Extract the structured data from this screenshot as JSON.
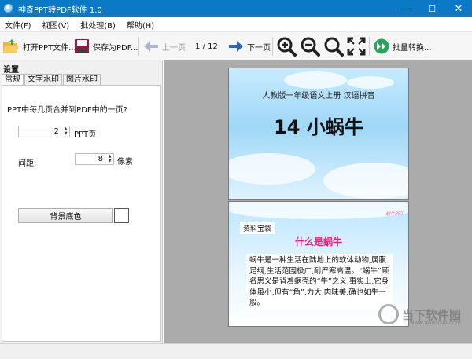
{
  "window": {
    "title": "神奇PPT转PDF软件 1.0",
    "controls": {
      "minimize": "—",
      "maximize": "☐",
      "close": "✕"
    }
  },
  "menu": [
    "文件(F)",
    "视图(V)",
    "批处理(B)",
    "帮助(H)"
  ],
  "toolbar": {
    "open_label": "打开PPT文件...",
    "save_label": "保存为PDF...",
    "prev_label": "上一页",
    "page_indicator": "1 / 12",
    "next_label": "下一页",
    "batch_label": "批量转换..."
  },
  "settings": {
    "panel_title": "设置",
    "tabs": [
      "常规",
      "文字水印",
      "图片水印"
    ],
    "pages_question": "PPT中每几页合并到PDF中的一页?",
    "pages_value": "2",
    "pages_unit": "PPT页",
    "spacing_label": "间距:",
    "spacing_value": "8",
    "spacing_unit": "像素",
    "bg_color_button": "背景底色"
  },
  "preview": {
    "slide1": {
      "subtitle": "人教版一年级语文上册    汉语拼音",
      "title": "14 小蜗牛"
    },
    "slide2": {
      "tag": "资料宝袋",
      "heading": "什么是蜗牛",
      "logo": "蜗牛PPT",
      "body": "蜗牛是一种生活在陆地上的软体动物,属腹足纲,生活范围极广,耐严寒高温。“蜗牛”顾名思义是背着蜗壳的“牛”之义,事实上,它身体虽小,但有“角”,力大,肉味美,确也如牛一般。"
    }
  },
  "watermark": {
    "name": "当下软件园",
    "url": "www.downxia.com"
  },
  "colors": {
    "titlebar": "#0b79c6",
    "preview_bg": "#ababab",
    "panel_bg": "#f0f0f0",
    "heading_pink": "#e8207a"
  }
}
